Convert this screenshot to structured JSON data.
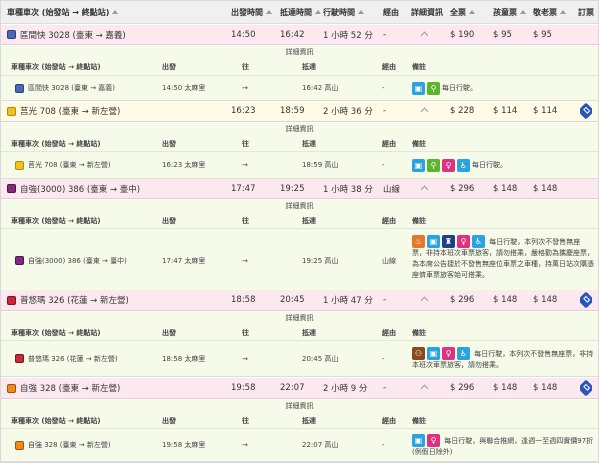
{
  "header": {
    "train": "車種車次 (始發站 → 終點站)",
    "depart": "出發時間",
    "arrive": "抵達時間",
    "duration": "行駛時間",
    "via": "經由",
    "details": "詳細資訊",
    "full": "全票",
    "child": "孩童票",
    "senior": "敬老票",
    "book": "訂票"
  },
  "detail_header": {
    "title": "詳細資訊",
    "train": "車種車次 (始發站 → 終點站)",
    "depart": "出發",
    "to": "往",
    "arrive": "抵達",
    "via": "經由",
    "note": "備註"
  },
  "trains": [
    {
      "name": "區間快 3028",
      "route": "(臺東 → 嘉義)",
      "depart": "14:50",
      "arrive": "16:42",
      "duration": "1 小時 52 分",
      "via": "-",
      "full": "$ 190",
      "child": "$ 95",
      "senior": "$ 95",
      "detail_route": "區間快 3028 (臺東 → 嘉義)",
      "detail_depart": "14:50 太麻里",
      "detail_to": "→",
      "detail_arrive": "16:42 高山",
      "detail_via": "-",
      "note": "每日行駛。"
    },
    {
      "name": "莒光 708",
      "route": "(臺東 → 新左營)",
      "depart": "16:23",
      "arrive": "18:59",
      "duration": "2 小時 36 分",
      "via": "-",
      "full": "$ 228",
      "child": "$ 114",
      "senior": "$ 114",
      "detail_route": "莒光 708 (臺東 → 新左營)",
      "detail_depart": "16:23 太麻里",
      "detail_to": "→",
      "detail_arrive": "18:59 高山",
      "detail_via": "-",
      "note": "每日行駛。"
    },
    {
      "name": "自強(3000) 386",
      "route": "(臺東 → 臺中)",
      "depart": "17:47",
      "arrive": "19:25",
      "duration": "1 小時 38 分",
      "via": "山線",
      "full": "$ 296",
      "child": "$ 148",
      "senior": "$ 148",
      "detail_route": "自強(3000) 386 (臺東 → 臺中)",
      "detail_depart": "17:47 太麻里",
      "detail_to": "→",
      "detail_arrive": "19:25 高山",
      "detail_via": "山線",
      "note": "每日行駛，本列次不發售無座票，非持本班次車票旅客，請勿搭乘，嚴格勸為攜慶座票，為本席公告捷於不發售無座位車票之車種，持萬日站次購憑座儕車票旅客始可搭乘。"
    },
    {
      "name": "普悠瑪 326",
      "route": "(花蓮 → 新左營)",
      "depart": "18:58",
      "arrive": "20:45",
      "duration": "1 小時 47 分",
      "via": "-",
      "full": "$ 296",
      "child": "$ 148",
      "senior": "$ 148",
      "detail_route": "普悠瑪 326 (花蓮 → 新左營)",
      "detail_depart": "18:58 太麻里",
      "detail_to": "→",
      "detail_arrive": "20:45 高山",
      "detail_via": "-",
      "note": "每日行駛，本列次不發售無座票，非持本班次車票旅客，請勿搭乘。"
    },
    {
      "name": "自強 328",
      "route": "(臺東 → 新左營)",
      "depart": "19:58",
      "arrive": "22:07",
      "duration": "2 小時 9 分",
      "via": "-",
      "full": "$ 296",
      "child": "$ 148",
      "senior": "$ 148",
      "detail_route": "自強 328 (臺東 → 新左營)",
      "detail_depart": "19:58 太麻里",
      "detail_to": "→",
      "detail_arrive": "22:07 高山",
      "detail_via": "-",
      "note": "每日行駛，與聯合推網，逢週一至週四實價97折(例假日除外)"
    }
  ],
  "icon_colors": {
    "local": "#4a66b8",
    "chukuang": "#f2c21b",
    "tzechiang": "#7d2b7d",
    "puyuma": "#c9283a",
    "tzechiang2": "#f08a1b",
    "booking": "#2a56b8"
  },
  "icons": [
    "calendar-icon",
    "bike-icon",
    "nursing-room-icon",
    "wheelchair-icon",
    "meal-icon",
    "priority-seat-icon",
    "group-icon"
  ]
}
